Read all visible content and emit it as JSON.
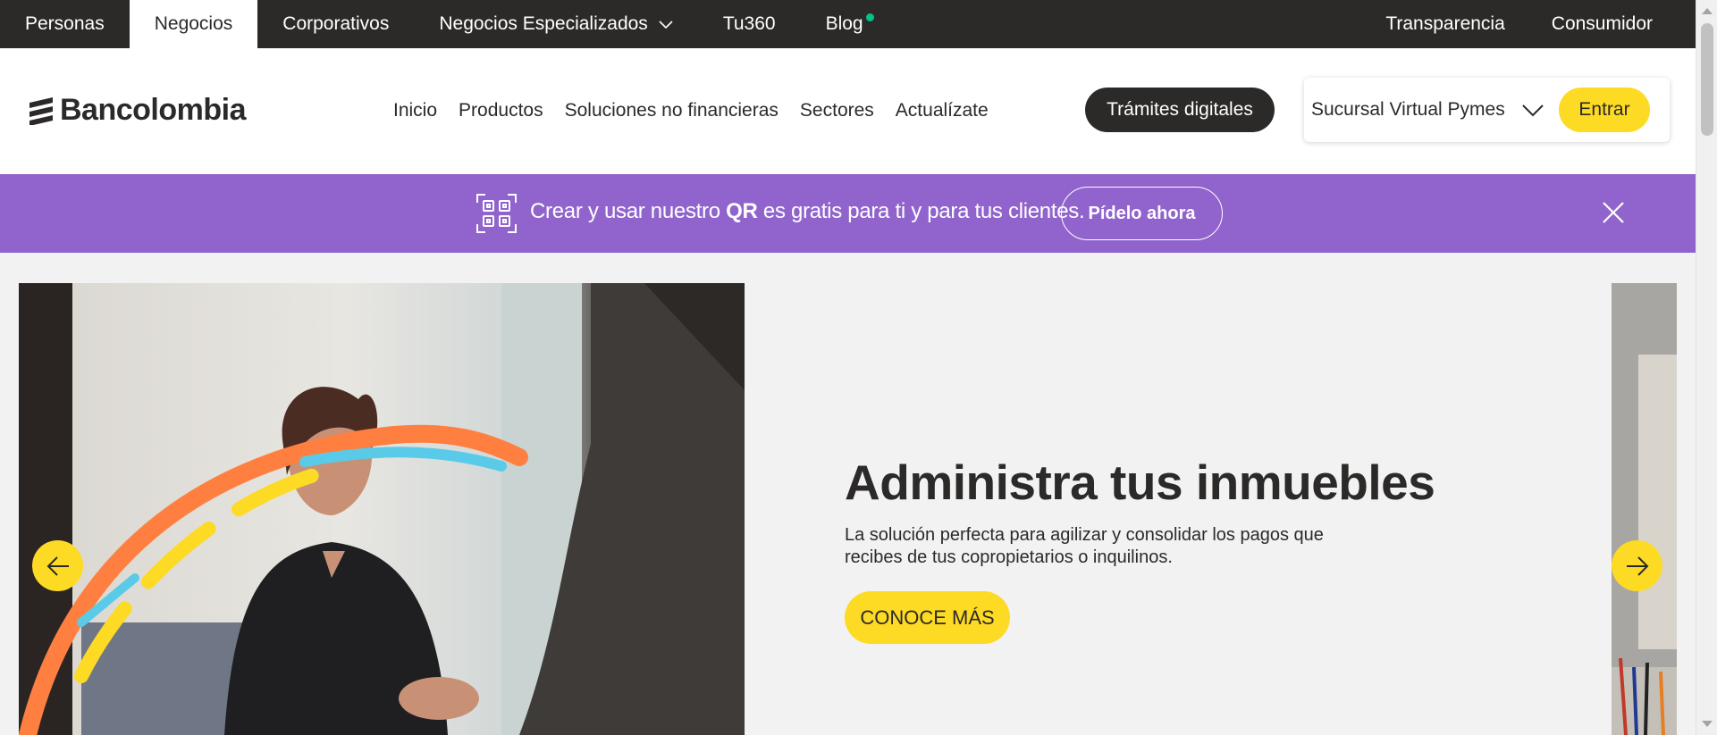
{
  "top_nav": {
    "tabs": [
      {
        "label": "Personas"
      },
      {
        "label": "Negocios"
      },
      {
        "label": "Corporativos"
      },
      {
        "label": "Negocios Especializados"
      },
      {
        "label": "Tu360"
      },
      {
        "label": "Blog"
      }
    ],
    "right": [
      {
        "label": "Transparencia"
      },
      {
        "label": "Consumidor"
      }
    ],
    "active_tab": "Negocios",
    "blog_dot_color": "#00c389"
  },
  "header": {
    "logo_text": "Bancolombia",
    "nav": [
      {
        "label": "Inicio"
      },
      {
        "label": "Productos"
      },
      {
        "label": "Soluciones no financieras"
      },
      {
        "label": "Sectores"
      },
      {
        "label": "Actualízate"
      }
    ],
    "tramites_label": "Trámites digitales",
    "login_select": "Sucursal Virtual Pymes",
    "login_button": "Entrar"
  },
  "promo": {
    "text_before": "Crear y usar nuestro ",
    "text_bold": "QR",
    "text_after": " es gratis para ti y para tus clientes.",
    "button_label": "Pídelo ahora",
    "background": "#9064cc"
  },
  "hero": {
    "title": "Administra tus inmuebles",
    "description": "La solución perfecta para agilizar y consolidar los pagos que recibes de tus copropietarios o inquilinos.",
    "cta_label": "CONOCE MÁS"
  },
  "colors": {
    "dark": "#2c2a29",
    "yellow": "#fdda24",
    "purple": "#9064cc",
    "background": "#f2f2f2"
  }
}
